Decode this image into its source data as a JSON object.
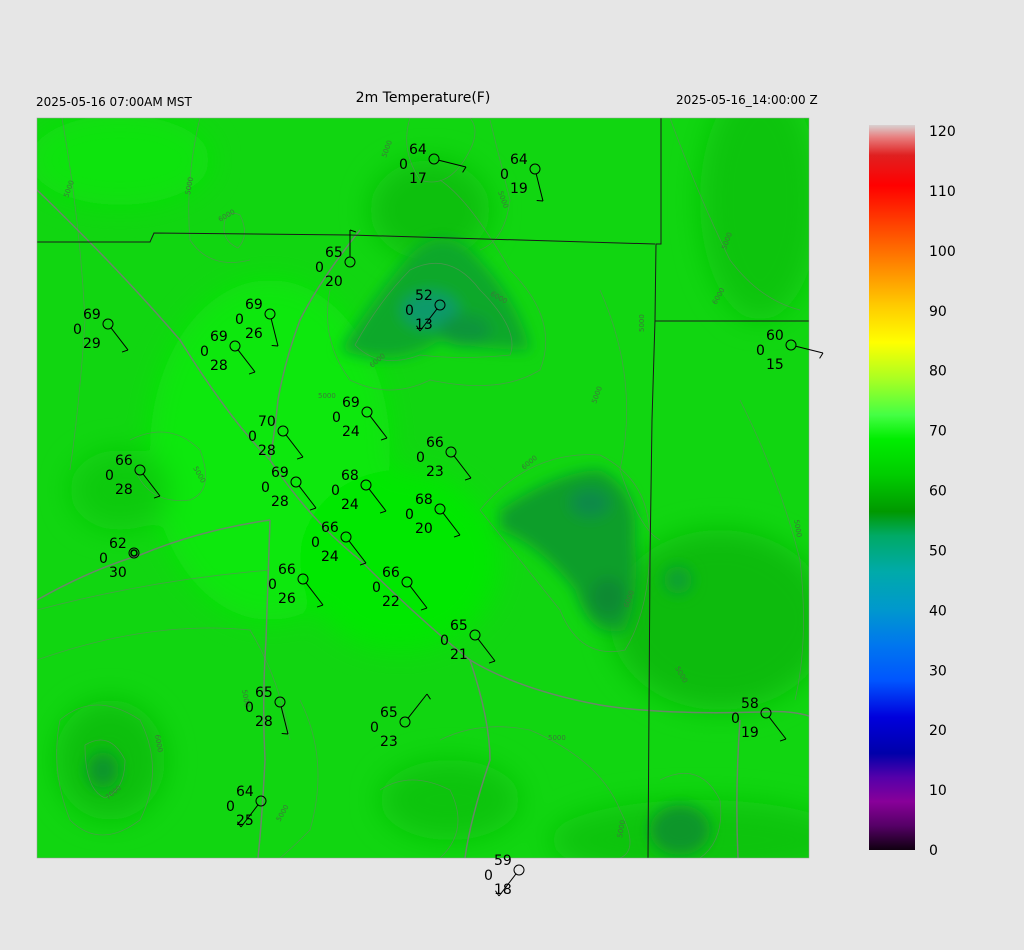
{
  "header": {
    "left_text": "2025-05-16 07:00AM MST",
    "title": "2m Temperature(F)",
    "right_text": "2025-05-16_14:00:00 Z"
  },
  "colorbar": {
    "ticks": [
      "120",
      "110",
      "100",
      "90",
      "80",
      "70",
      "60",
      "50",
      "40",
      "30",
      "20",
      "10",
      "0"
    ],
    "stops": [
      {
        "value": 120,
        "color": "#d8d0d0"
      },
      {
        "value": 118,
        "color": "#e88080"
      },
      {
        "value": 115,
        "color": "#e02020"
      },
      {
        "value": 110,
        "color": "#ff0000"
      },
      {
        "value": 100,
        "color": "#ff6600"
      },
      {
        "value": 95,
        "color": "#ff9900"
      },
      {
        "value": 90,
        "color": "#ffcc00"
      },
      {
        "value": 84,
        "color": "#ffff00"
      },
      {
        "value": 78,
        "color": "#aaff22"
      },
      {
        "value": 72,
        "color": "#44ff44"
      },
      {
        "value": 68,
        "color": "#00ee00"
      },
      {
        "value": 62,
        "color": "#00cc00"
      },
      {
        "value": 56,
        "color": "#009900"
      },
      {
        "value": 52,
        "color": "#00aa66"
      },
      {
        "value": 46,
        "color": "#00aaaa"
      },
      {
        "value": 40,
        "color": "#0099cc"
      },
      {
        "value": 34,
        "color": "#0077ee"
      },
      {
        "value": 28,
        "color": "#0055ff"
      },
      {
        "value": 22,
        "color": "#0000dd"
      },
      {
        "value": 16,
        "color": "#0000aa"
      },
      {
        "value": 12,
        "color": "#5500aa"
      },
      {
        "value": 8,
        "color": "#880099"
      },
      {
        "value": 4,
        "color": "#550066"
      },
      {
        "value": 0,
        "color": "#100010"
      }
    ]
  },
  "stations": [
    {
      "temp": "64",
      "precip": "0",
      "dew": "17"
    },
    {
      "temp": "64",
      "precip": "0",
      "dew": "19"
    },
    {
      "temp": "65",
      "precip": "0",
      "dew": "20"
    },
    {
      "temp": "52",
      "precip": "0",
      "dew": "13"
    },
    {
      "temp": "69",
      "precip": "0",
      "dew": "29"
    },
    {
      "temp": "69",
      "precip": "0",
      "dew": "26"
    },
    {
      "temp": "69",
      "precip": "0",
      "dew": "28"
    },
    {
      "temp": "60",
      "precip": "0",
      "dew": "15"
    },
    {
      "temp": "69",
      "precip": "0",
      "dew": "24"
    },
    {
      "temp": "70",
      "precip": "0",
      "dew": "28"
    },
    {
      "temp": "66",
      "precip": "0",
      "dew": "23"
    },
    {
      "temp": "66",
      "precip": "0",
      "dew": "28"
    },
    {
      "temp": "69",
      "precip": "0",
      "dew": "28"
    },
    {
      "temp": "68",
      "precip": "0",
      "dew": "24"
    },
    {
      "temp": "68",
      "precip": "0",
      "dew": "20"
    },
    {
      "temp": "62",
      "precip": "0",
      "dew": "30"
    },
    {
      "temp": "66",
      "precip": "0",
      "dew": "24"
    },
    {
      "temp": "66",
      "precip": "0",
      "dew": "26"
    },
    {
      "temp": "66",
      "precip": "0",
      "dew": "22"
    },
    {
      "temp": "65",
      "precip": "0",
      "dew": "21"
    },
    {
      "temp": "65",
      "precip": "0",
      "dew": "28"
    },
    {
      "temp": "65",
      "precip": "0",
      "dew": "23"
    },
    {
      "temp": "58",
      "precip": "0",
      "dew": "19"
    },
    {
      "temp": "64",
      "precip": "0",
      "dew": "25"
    },
    {
      "temp": "59",
      "precip": "0",
      "dew": "18"
    }
  ]
}
